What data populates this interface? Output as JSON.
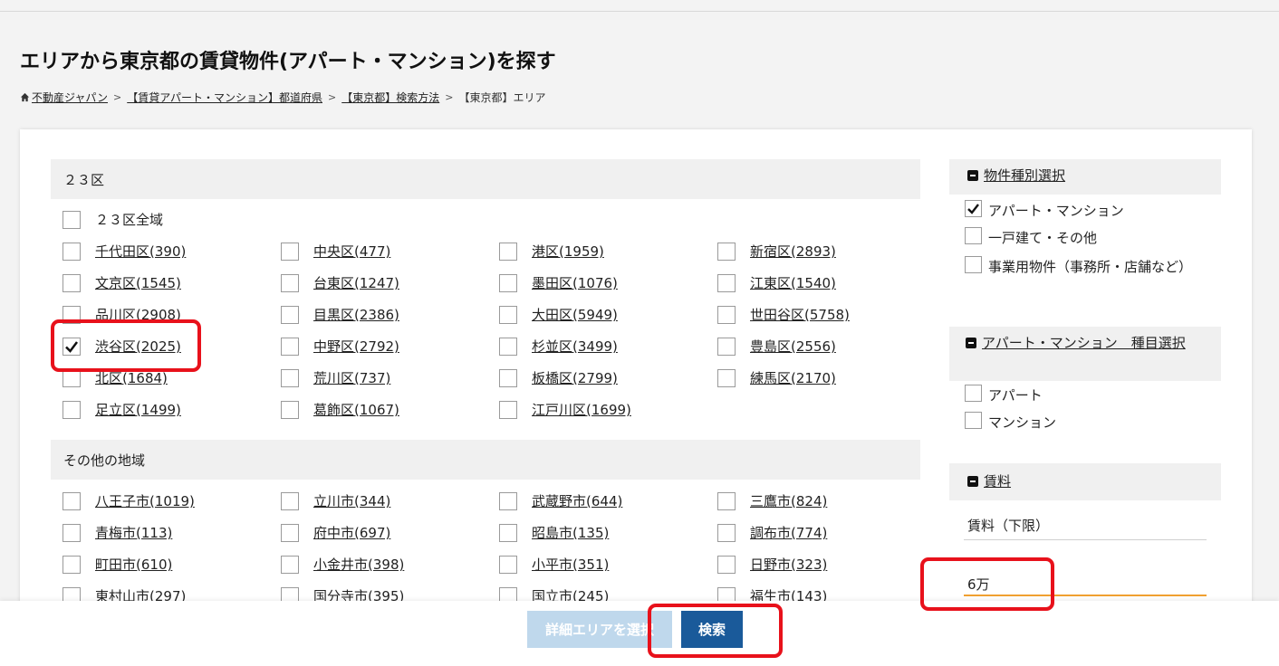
{
  "page": {
    "title": "エリアから東京都の賃貸物件(アパート・マンション)を探す",
    "breadcrumb": [
      {
        "label": "不動産ジャパン"
      },
      {
        "label": "【賃貸アパート・マンション】都道府県"
      },
      {
        "label": "【東京都】検索方法"
      },
      {
        "label": "【東京都】エリア"
      }
    ]
  },
  "wards": {
    "heading": "２３区",
    "all_label": "２３区全域",
    "items": [
      {
        "label": "千代田区(390)",
        "checked": false
      },
      {
        "label": "中央区(477)",
        "checked": false
      },
      {
        "label": "港区(1959)",
        "checked": false
      },
      {
        "label": "新宿区(2893)",
        "checked": false
      },
      {
        "label": "文京区(1545)",
        "checked": false
      },
      {
        "label": "台東区(1247)",
        "checked": false
      },
      {
        "label": "墨田区(1076)",
        "checked": false
      },
      {
        "label": "江東区(1540)",
        "checked": false
      },
      {
        "label": "品川区(2908)",
        "checked": false
      },
      {
        "label": "目黒区(2386)",
        "checked": false
      },
      {
        "label": "大田区(5949)",
        "checked": false
      },
      {
        "label": "世田谷区(5758)",
        "checked": false
      },
      {
        "label": "渋谷区(2025)",
        "checked": true
      },
      {
        "label": "中野区(2792)",
        "checked": false
      },
      {
        "label": "杉並区(3499)",
        "checked": false
      },
      {
        "label": "豊島区(2556)",
        "checked": false
      },
      {
        "label": "北区(1684)",
        "checked": false
      },
      {
        "label": "荒川区(737)",
        "checked": false
      },
      {
        "label": "板橋区(2799)",
        "checked": false
      },
      {
        "label": "練馬区(2170)",
        "checked": false
      },
      {
        "label": "足立区(1499)",
        "checked": false
      },
      {
        "label": "葛飾区(1067)",
        "checked": false
      },
      {
        "label": "江戸川区(1699)",
        "checked": false
      }
    ]
  },
  "other": {
    "heading": "その他の地域",
    "items": [
      {
        "label": "八王子市(1019)",
        "checked": false
      },
      {
        "label": "立川市(344)",
        "checked": false
      },
      {
        "label": "武蔵野市(644)",
        "checked": false
      },
      {
        "label": "三鷹市(824)",
        "checked": false
      },
      {
        "label": "青梅市(113)",
        "checked": false
      },
      {
        "label": "府中市(697)",
        "checked": false
      },
      {
        "label": "昭島市(135)",
        "checked": false
      },
      {
        "label": "調布市(774)",
        "checked": false
      },
      {
        "label": "町田市(610)",
        "checked": false
      },
      {
        "label": "小金井市(398)",
        "checked": false
      },
      {
        "label": "小平市(351)",
        "checked": false
      },
      {
        "label": "日野市(323)",
        "checked": false
      },
      {
        "label": "東村山市(297)",
        "checked": false
      },
      {
        "label": "国分寺市(395)",
        "checked": false
      },
      {
        "label": "国立市(245)",
        "checked": false
      },
      {
        "label": "福生市(143)",
        "checked": false
      }
    ]
  },
  "sidebar": {
    "property_type": {
      "heading": "物件種別選択",
      "items": [
        {
          "label": "アパート・マンション",
          "checked": true
        },
        {
          "label": "一戸建て・その他",
          "checked": false
        },
        {
          "label": "事業用物件（事務所・店舗など）",
          "checked": false
        }
      ]
    },
    "apartment_type": {
      "heading": "アパート・マンション　種目選択",
      "items": [
        {
          "label": "アパート",
          "checked": false
        },
        {
          "label": "マンション",
          "checked": false
        }
      ]
    },
    "rent": {
      "heading": "賃料",
      "min_label": "賃料（下限）",
      "min_value": "6万"
    }
  },
  "footer": {
    "area_button": "詳細エリアを選択",
    "search_button": "検索"
  },
  "colors": {
    "primary": "#1a5a9a",
    "primary_disabled": "#bfd8ec",
    "highlight": "#e8111b",
    "accent": "#f0a030"
  }
}
